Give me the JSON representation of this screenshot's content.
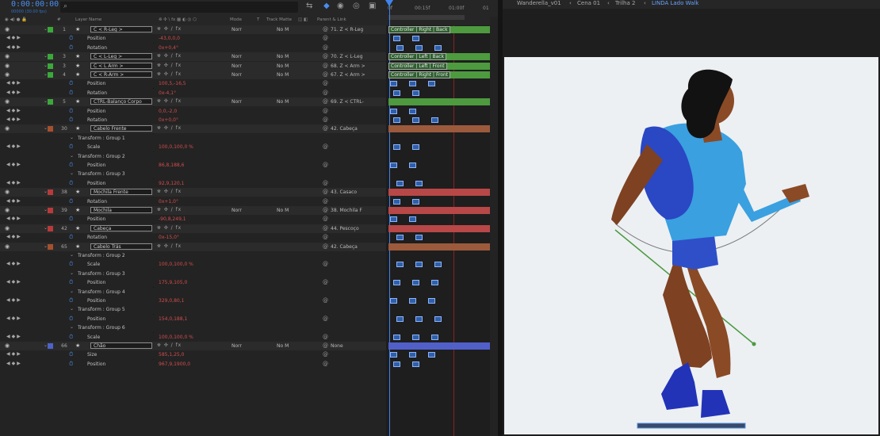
{
  "timeline": {
    "timecode": "0:00:00:00",
    "frames": "00000 (30.00 fps)",
    "search_placeholder": "",
    "ruler": [
      "0f",
      "00:15f",
      "01:00f",
      "01"
    ],
    "headers": {
      "num": "#",
      "layer_name": "Layer Name",
      "mode": "Mode",
      "t": "T",
      "track_matte": "Track Matte",
      "parent": "Parent & Link"
    }
  },
  "rows": [
    {
      "kind": "layer",
      "num": "1",
      "name": "C < R-Leg >",
      "color": "#3aa83a",
      "mode": "Norr",
      "matte": "No M",
      "parent": "71. Z < R-Leg",
      "bar": "#4d9a3f",
      "label": "Controller | Right | Back"
    },
    {
      "kind": "prop",
      "name": "Position",
      "value": "-43,0,0,0"
    },
    {
      "kind": "prop",
      "name": "Rotation",
      "value": "0x+0,4°"
    },
    {
      "kind": "layer",
      "num": "3",
      "name": "C < L-Leg >",
      "color": "#3aa83a",
      "mode": "Norr",
      "matte": "No M",
      "parent": "70. Z < L-Leg",
      "bar": "#4d9a3f",
      "label": "Controller | Left | Back"
    },
    {
      "kind": "layer",
      "num": "3",
      "name": "C < L Arm >",
      "color": "#3aa83a",
      "mode": "Norr",
      "matte": "No M",
      "parent": "68. Z < Arm >",
      "bar": "#4d9a3f",
      "label": "Controller | Left | Front"
    },
    {
      "kind": "layer",
      "num": "4",
      "name": "C < R-Arm >",
      "color": "#3aa83a",
      "mode": "Norr",
      "matte": "No M",
      "parent": "67. Z < Arm >",
      "bar": "#4d9a3f",
      "label": "Controller | Right | Front"
    },
    {
      "kind": "prop",
      "name": "Position",
      "value": "100,5,-16,5"
    },
    {
      "kind": "prop",
      "name": "Rotation",
      "value": "0x-4,1°"
    },
    {
      "kind": "layer",
      "num": "5",
      "name": "CTRL-Balanço Corpo",
      "color": "#3aa83a",
      "mode": "Norr",
      "matte": "No M",
      "parent": "69. Z < CTRL-",
      "bar": "#4d9a3f",
      "label": ""
    },
    {
      "kind": "prop",
      "name": "Position",
      "value": "0,0,-2,0"
    },
    {
      "kind": "prop",
      "name": "Rotation",
      "value": "0x+0,0°"
    },
    {
      "kind": "layer",
      "num": "30",
      "name": "Cabelo Frente",
      "color": "#a5502f",
      "mode": "",
      "matte": "",
      "parent": "42. Cabeça",
      "bar": "#9c5a3c",
      "label": ""
    },
    {
      "kind": "group",
      "name": "Transform : Group 1"
    },
    {
      "kind": "prop",
      "name": "Scale",
      "value": "100,0,100,0 %"
    },
    {
      "kind": "group",
      "name": "Transform : Group 2"
    },
    {
      "kind": "prop",
      "name": "Position",
      "value": "86,8,188,6"
    },
    {
      "kind": "group",
      "name": "Transform : Group 3"
    },
    {
      "kind": "prop",
      "name": "Position",
      "value": "92,9,120,1"
    },
    {
      "kind": "layer",
      "num": "38",
      "name": "Mochila Frente",
      "color": "#b83a3a",
      "mode": "",
      "matte": "",
      "parent": "43. Casaco",
      "bar": "#b84747",
      "label": ""
    },
    {
      "kind": "prop",
      "name": "Rotation",
      "value": "0x+1,0°"
    },
    {
      "kind": "layer",
      "num": "39",
      "name": "Mochila",
      "color": "#b83a3a",
      "mode": "Norr",
      "matte": "No M",
      "parent": "38. Mochila F",
      "bar": "#b84747",
      "label": ""
    },
    {
      "kind": "prop",
      "name": "Position",
      "value": "-90,8,249,1"
    },
    {
      "kind": "layer",
      "num": "42",
      "name": "Cabeça",
      "color": "#b83a3a",
      "mode": "",
      "matte": "",
      "parent": "44. Pescoço",
      "bar": "#b84747",
      "label": ""
    },
    {
      "kind": "prop",
      "name": "Rotation",
      "value": "0x-15,0°"
    },
    {
      "kind": "layer",
      "num": "65",
      "name": "Cabelo Trás",
      "color": "#a5502f",
      "mode": "",
      "matte": "",
      "parent": "42. Cabeça",
      "bar": "#9c5a3c",
      "label": ""
    },
    {
      "kind": "group",
      "name": "Transform : Group 2"
    },
    {
      "kind": "prop",
      "name": "Scale",
      "value": "100,0,100,0 %"
    },
    {
      "kind": "group",
      "name": "Transform : Group 3"
    },
    {
      "kind": "prop",
      "name": "Position",
      "value": "175,9,105,0"
    },
    {
      "kind": "group",
      "name": "Transform : Group 4"
    },
    {
      "kind": "prop",
      "name": "Position",
      "value": "329,0,80,1"
    },
    {
      "kind": "group",
      "name": "Transform : Group 5"
    },
    {
      "kind": "prop",
      "name": "Position",
      "value": "154,0,188,1"
    },
    {
      "kind": "group",
      "name": "Transform : Group 6"
    },
    {
      "kind": "prop",
      "name": "Scale",
      "value": "100,0,100,0 %"
    },
    {
      "kind": "layer",
      "num": "66",
      "name": "Chão",
      "color": "#4d63c9",
      "mode": "Norr",
      "matte": "No M",
      "parent": "None",
      "bar": "#5060c8",
      "label": ""
    },
    {
      "kind": "prop",
      "name": "Size",
      "value": "585,1,25,0"
    },
    {
      "kind": "prop",
      "name": "Position",
      "value": "967,9,1900,0"
    }
  ],
  "comp": {
    "breadcrumbs": [
      "Wanderella_v01",
      "Cena 01",
      "Trilha 2",
      "LINDA Lado Walk"
    ],
    "colors": {
      "skin": "#8a4a26",
      "jacket": "#3aa0e0",
      "jacket_dark": "#1e5fb8",
      "backpack": "#2a47c4",
      "hair": "#121212",
      "shorts": "#2f4fc9",
      "shoe": "#2233b8",
      "accent": "#4c8fe0"
    }
  }
}
